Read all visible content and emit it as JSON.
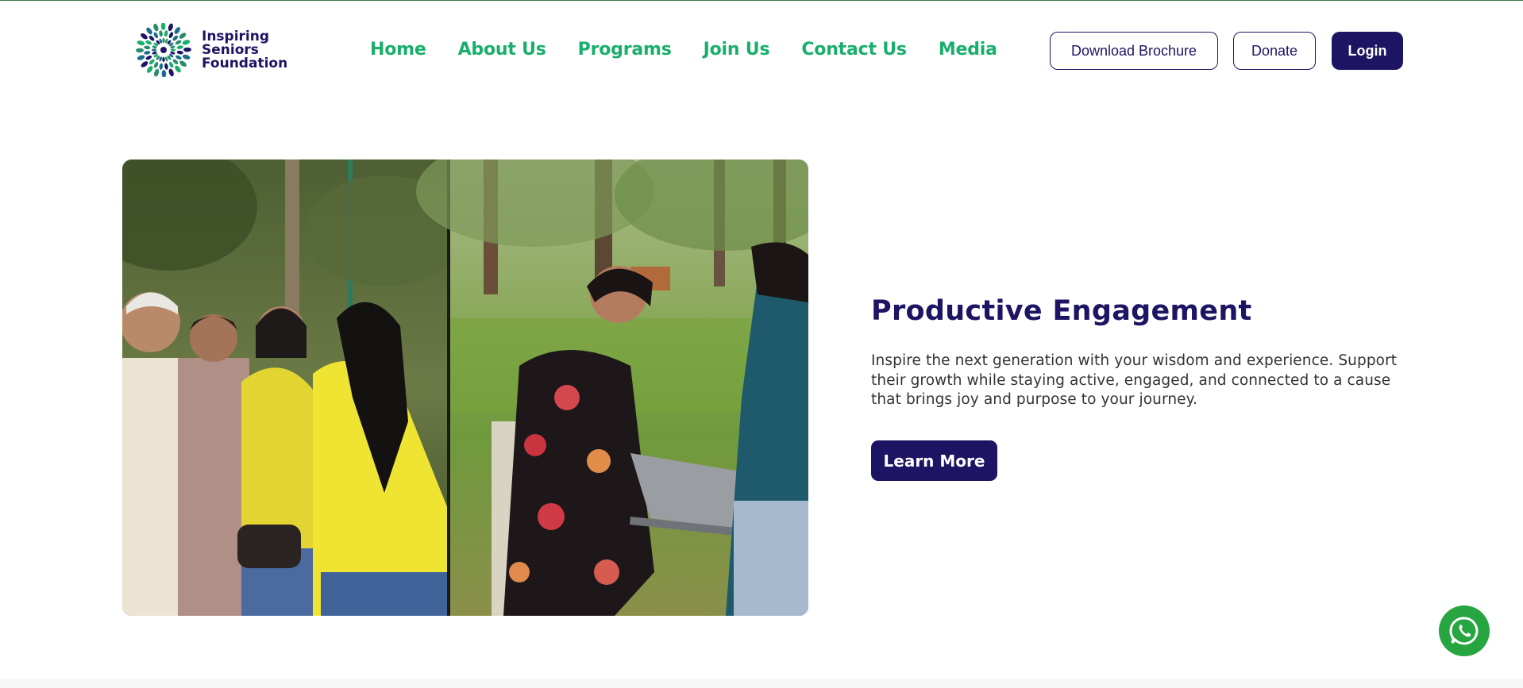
{
  "brand": {
    "logo_lines": [
      "Inspiring",
      "Seniors",
      "Foundation"
    ],
    "primary_color": "#1d1464",
    "accent_color": "#1aae6c"
  },
  "nav": {
    "items": [
      {
        "label": "Home"
      },
      {
        "label": "About Us"
      },
      {
        "label": "Programs"
      },
      {
        "label": "Join Us"
      },
      {
        "label": "Contact Us"
      },
      {
        "label": "Media"
      }
    ]
  },
  "header_actions": {
    "download_label": "Download Brochure",
    "donate_label": "Donate",
    "login_label": "Login"
  },
  "hero": {
    "image_icon": "photo-collage-seniors-in-park",
    "title": "Productive Engagement",
    "description": "Inspire the next generation with your wisdom and experience. Support their growth while staying active, engaged, and connected to a cause that brings joy and purpose to your journey.",
    "cta_label": "Learn More"
  },
  "floating": {
    "whatsapp_icon": "whatsapp-icon",
    "whatsapp_color": "#27a540"
  }
}
